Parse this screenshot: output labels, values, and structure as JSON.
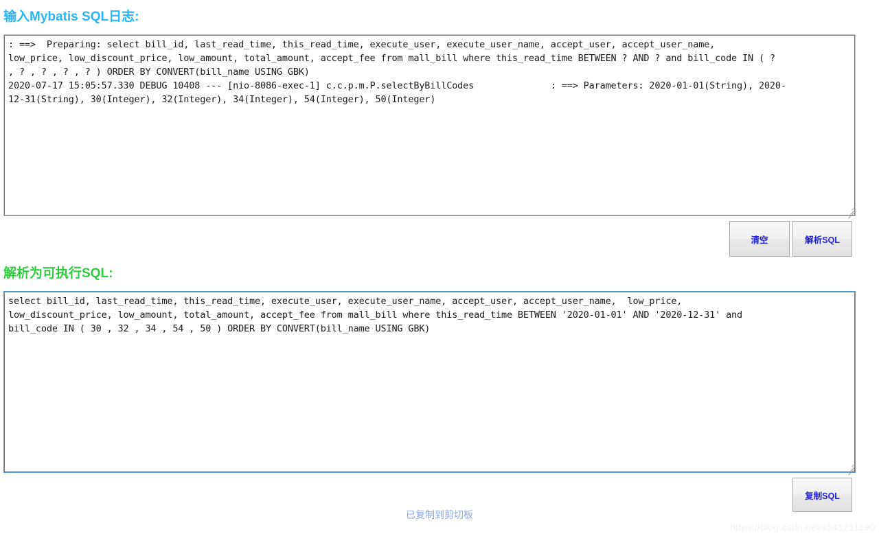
{
  "page": {
    "background_color": "#ffffff",
    "watermark": "https://blog.csdn.net/x541211190"
  },
  "input_section": {
    "heading": "输入Mybatis SQL日志:",
    "heading_color": "#29b6f6",
    "textarea": {
      "name": "mybatis-log-input",
      "placeholder": "",
      "border_color": "#c0c0c0",
      "value": ": ==>  Preparing: select bill_id, last_read_time, this_read_time, execute_user, execute_user_name, accept_user, accept_user_name,\nlow_price, low_discount_price, low_amount, total_amount, accept_fee from mall_bill where this_read_time BETWEEN ? AND ? and bill_code IN ( ?\n, ? , ? , ? , ? ) ORDER BY CONVERT(bill_name USING GBK)\n2020-07-17 15:05:57.330 DEBUG 10408 --- [nio-8086-exec-1] c.c.p.m.P.selectByBillCodes              : ==> Parameters: 2020-01-01(String), 2020-\n12-31(String), 30(Integer), 32(Integer), 34(Integer), 54(Integer), 50(Integer)"
    },
    "buttons": {
      "clear_label": "清空",
      "parse_label": "解析SQL",
      "text_color": "#2222dd"
    }
  },
  "output_section": {
    "heading": "解析为可执行SQL:",
    "heading_color": "#2fcc3f",
    "textarea": {
      "name": "executable-sql-output",
      "placeholder": "",
      "border_color": "#5b9bd5",
      "value": "select bill_id, last_read_time, this_read_time, execute_user, execute_user_name, accept_user, accept_user_name,  low_price,\nlow_discount_price, low_amount, total_amount, accept_fee from mall_bill where this_read_time BETWEEN '2020-01-01' AND '2020-12-31' and\nbill_code IN ( 30 , 32 , 34 , 54 , 50 ) ORDER BY CONVERT(bill_name USING GBK)"
    },
    "buttons": {
      "copy_label": "复制SQL",
      "text_color": "#2222dd"
    },
    "status_message": "已复制到剪切板",
    "status_color": "#8ea6f0"
  }
}
